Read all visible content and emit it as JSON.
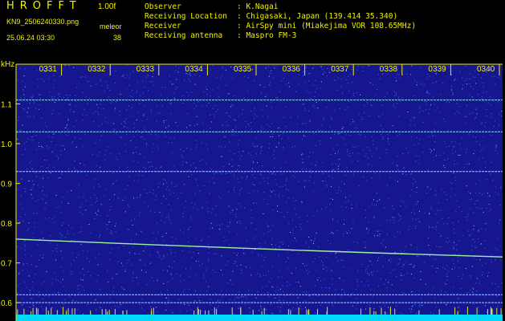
{
  "header": {
    "app_title": "HROFFT",
    "version": "1.00f",
    "file_name": "KN9_2506240330.png",
    "mode": "meleor",
    "datetime": "25.06.24 03:30",
    "frame_number": "38",
    "info": [
      {
        "key": "Observer",
        "value": ": K.Nagai"
      },
      {
        "key": "Receiving Location",
        "value": ": Chigasaki, Japan (139.414 35.340)"
      },
      {
        "key": "Receiver",
        "value": ": AirSpy mini (Miakejima VOR 108.65MHz)"
      },
      {
        "key": "Receiving antenna",
        "value": ": Maspro FM-3"
      }
    ]
  },
  "spectrogram": {
    "unit_label": "kHz",
    "freq_ticks": [
      "1.1",
      "1.0",
      "0.9",
      "0.8",
      "0.7",
      "0.6"
    ],
    "freq_values": [
      1.1,
      1.0,
      0.9,
      0.8,
      0.7,
      0.6
    ],
    "freq_range": [
      0.57,
      1.2
    ],
    "time_ticks": [
      "0331",
      "0332",
      "0333",
      "0334",
      "0335",
      "0336",
      "0337",
      "0338",
      "0339",
      "0340"
    ],
    "carrier_lines_khz": [
      1.11,
      1.03,
      0.93,
      0.62,
      0.6
    ],
    "drifting_signal_khz": {
      "start": 0.76,
      "end": 0.715
    },
    "colors": {
      "background": "#16168f",
      "noise": "#3a6cff",
      "carrier": "#8fd8ff",
      "signal": "#9ff0a8",
      "axis": "#f0f000",
      "bottom_band": "#00d8ff"
    }
  }
}
